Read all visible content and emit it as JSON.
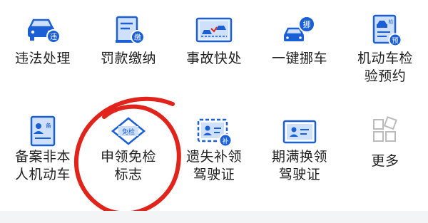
{
  "grid": {
    "items": [
      {
        "label_lines": [
          "违法处理"
        ],
        "icon": "car-violation-icon",
        "badge": "违"
      },
      {
        "label_lines": [
          "罚款缴纳"
        ],
        "icon": "fine-payment-icon",
        "badge": "缴"
      },
      {
        "label_lines": [
          "事故快处"
        ],
        "icon": "accident-icon",
        "badge": ""
      },
      {
        "label_lines": [
          "一键挪车"
        ],
        "icon": "move-car-icon",
        "badge": "挪"
      },
      {
        "label_lines": [
          "机动车检",
          "验预约"
        ],
        "icon": "inspection-booking-icon",
        "badge": "预",
        "badge_top": "检"
      },
      {
        "label_lines": [
          "备案非本",
          "人机动车"
        ],
        "icon": "register-vehicle-icon",
        "badge": "备"
      },
      {
        "label_lines": [
          "申领免检",
          "标志"
        ],
        "icon": "exemption-label-icon",
        "badge": "免检"
      },
      {
        "label_lines": [
          "遗失补领",
          "驾驶证"
        ],
        "icon": "replace-license-icon",
        "badge": "补"
      },
      {
        "label_lines": [
          "期满换领",
          "驾驶证"
        ],
        "icon": "renew-license-icon",
        "badge": ""
      },
      {
        "label_lines": [
          "更多"
        ],
        "icon": "more-grid-icon",
        "badge": ""
      }
    ]
  },
  "colors": {
    "accent": "#1a5fd6",
    "light_blue": "#cfe0fb",
    "annotation": "#e0241b",
    "text": "#222222"
  }
}
